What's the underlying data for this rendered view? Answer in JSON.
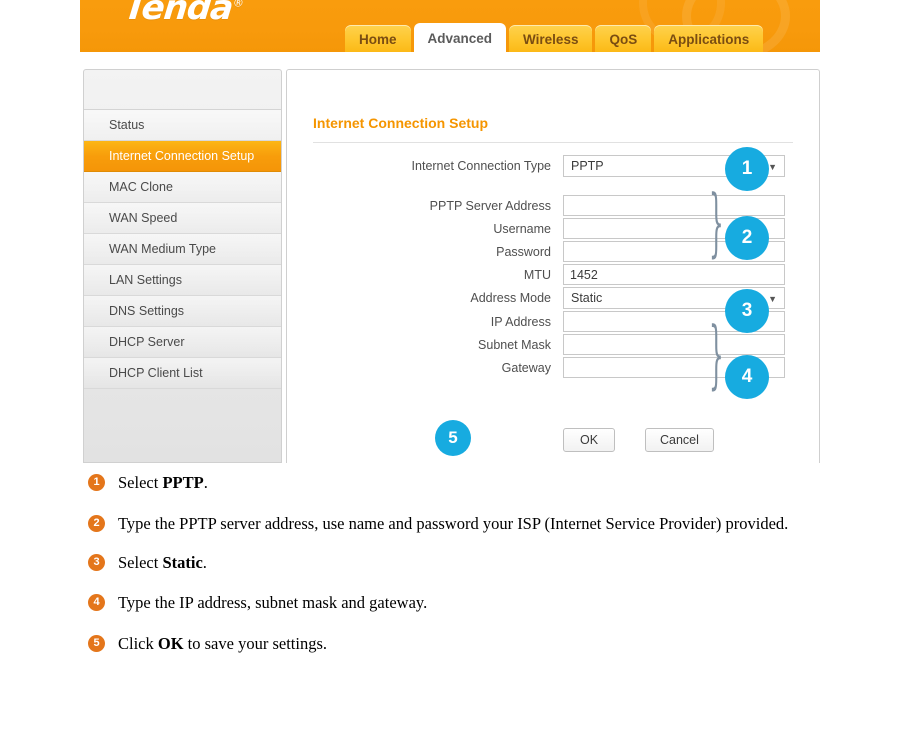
{
  "brand": {
    "name": "Tenda",
    "registered_mark": "®"
  },
  "tabs": [
    {
      "label": "Home",
      "active": false
    },
    {
      "label": "Advanced",
      "active": true
    },
    {
      "label": "Wireless",
      "active": false
    },
    {
      "label": "QoS",
      "active": false
    },
    {
      "label": "Applications",
      "active": false
    }
  ],
  "sidebar": {
    "items": [
      {
        "label": "Status",
        "selected": false
      },
      {
        "label": "Internet Connection Setup",
        "selected": true
      },
      {
        "label": "MAC Clone",
        "selected": false
      },
      {
        "label": "WAN Speed",
        "selected": false
      },
      {
        "label": "WAN Medium Type",
        "selected": false
      },
      {
        "label": "LAN Settings",
        "selected": false
      },
      {
        "label": "DNS Settings",
        "selected": false
      },
      {
        "label": "DHCP Server",
        "selected": false
      },
      {
        "label": "DHCP Client List",
        "selected": false
      }
    ]
  },
  "panel": {
    "title": "Internet Connection Setup",
    "fields": {
      "connection_type": {
        "label": "Internet Connection Type",
        "value": "PPTP",
        "type": "select"
      },
      "server_address": {
        "label": "PPTP Server Address",
        "value": "",
        "placeholder": "",
        "type": "text"
      },
      "username": {
        "label": "Username",
        "value": "",
        "placeholder": "",
        "type": "text"
      },
      "password": {
        "label": "Password",
        "value": "",
        "placeholder": "",
        "type": "password"
      },
      "mtu": {
        "label": "MTU",
        "value": "1452",
        "placeholder": "",
        "type": "text"
      },
      "address_mode": {
        "label": "Address Mode",
        "value": "Static",
        "type": "select"
      },
      "ip_address": {
        "label": "IP Address",
        "value": "",
        "placeholder": "",
        "type": "text"
      },
      "subnet_mask": {
        "label": "Subnet Mask",
        "value": "",
        "placeholder": "",
        "type": "text"
      },
      "gateway": {
        "label": "Gateway",
        "value": "",
        "placeholder": "",
        "type": "text"
      }
    },
    "buttons": {
      "ok": "OK",
      "cancel": "Cancel"
    }
  },
  "callouts": [
    {
      "number": "1"
    },
    {
      "number": "2"
    },
    {
      "number": "3"
    },
    {
      "number": "4"
    },
    {
      "number": "5"
    }
  ],
  "steps": [
    {
      "number": "1",
      "text_before": "Select ",
      "text_bold": "PPTP",
      "text_after": "."
    },
    {
      "number": "2",
      "text_before": " Type the PPTP server address, use name and password your ISP (Internet Service Provider) provided.",
      "text_bold": "",
      "text_after": ""
    },
    {
      "number": "3",
      "text_before": "Select ",
      "text_bold": "Static",
      "text_after": "."
    },
    {
      "number": "4",
      "text_before": "Type the IP address, subnet mask and gateway.",
      "text_bold": "",
      "text_after": ""
    },
    {
      "number": "5",
      "text_before": "Click ",
      "text_bold": "OK",
      "text_after": " to save your settings."
    }
  ],
  "colors": {
    "header_orange": "#f89a0c",
    "tab_yellow": "#fec62e",
    "sidebar_selected": "#f89d0b",
    "badge_blue": "#17abe0",
    "bullet_orange": "#e4761b",
    "panel_title": "#f59500",
    "brace_gray": "#7f90a0"
  }
}
